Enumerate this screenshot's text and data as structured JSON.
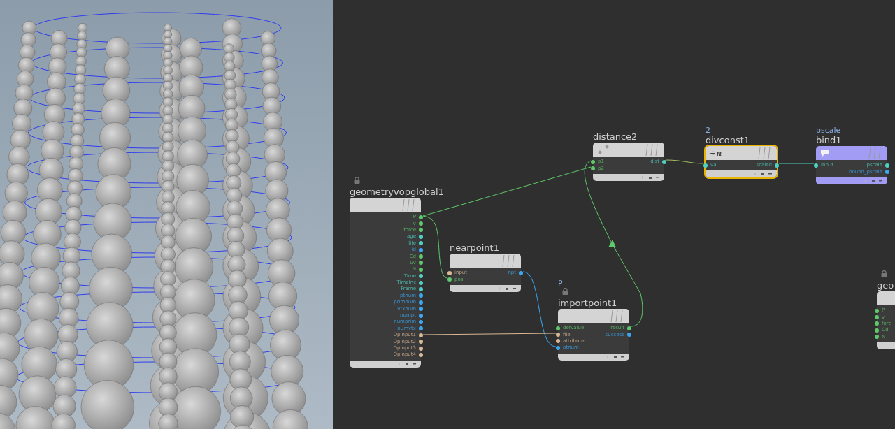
{
  "network": {
    "nodes": [
      {
        "kind": "distance",
        "name": "distance2",
        "locked": false,
        "selected": false,
        "inputs": [
          {
            "name": "p1",
            "color": "#5ec86a"
          },
          {
            "name": "p2",
            "color": "#5ec86a"
          }
        ],
        "outputs": [
          {
            "name": "dist",
            "color": "#4fd1c1"
          }
        ]
      },
      {
        "kind": "divconst",
        "label": "2",
        "name": "divconst1",
        "symbol": "÷n",
        "locked": false,
        "selected": true,
        "inputs": [
          {
            "name": "val",
            "color": "#4fd1c1"
          }
        ],
        "outputs": [
          {
            "name": "scaled",
            "color": "#4fd1c1"
          }
        ]
      },
      {
        "kind": "bind",
        "label": "pscale",
        "name": "bind1",
        "locked": false,
        "selected": false,
        "inputs": [
          {
            "name": "input",
            "color": "#4fd1c1"
          }
        ],
        "outputs": [
          {
            "name": "pscale",
            "color": "#4fd1c1"
          },
          {
            "name": "bound_pscale",
            "color": "#3aa8f0"
          }
        ]
      },
      {
        "kind": "default",
        "name": "geometryvopglobal1",
        "locked": true,
        "selected": false,
        "outputs": [
          {
            "name": "P",
            "color": "#5ec86a"
          },
          {
            "name": "v",
            "color": "#5ec86a"
          },
          {
            "name": "force",
            "color": "#5ec86a"
          },
          {
            "name": "age",
            "color": "#4fd1c1"
          },
          {
            "name": "life",
            "color": "#4fd1c1"
          },
          {
            "name": "id",
            "color": "#3aa8f0"
          },
          {
            "name": "Cd",
            "color": "#5ec86a"
          },
          {
            "name": "uv",
            "color": "#5ec86a"
          },
          {
            "name": "N",
            "color": "#5ec86a"
          },
          {
            "name": "Time",
            "color": "#4fd1c1"
          },
          {
            "name": "TimeInc",
            "color": "#4fd1c1"
          },
          {
            "name": "Frame",
            "color": "#4fd1c1"
          },
          {
            "name": "ptnum",
            "color": "#3aa8f0"
          },
          {
            "name": "primnum",
            "color": "#3aa8f0"
          },
          {
            "name": "vtxnum",
            "color": "#3aa8f0"
          },
          {
            "name": "numpt",
            "color": "#3aa8f0"
          },
          {
            "name": "numprim",
            "color": "#3aa8f0"
          },
          {
            "name": "numvtx",
            "color": "#3aa8f0"
          },
          {
            "name": "OpInput1",
            "color": "#d9b894"
          },
          {
            "name": "OpInput2",
            "color": "#d9b894"
          },
          {
            "name": "OpInput3",
            "color": "#d9b894"
          },
          {
            "name": "OpInput4",
            "color": "#d9b894"
          }
        ]
      },
      {
        "kind": "default",
        "name": "nearpoint1",
        "locked": false,
        "selected": false,
        "inputs": [
          {
            "name": "input",
            "color": "#d9b894"
          },
          {
            "name": "pos",
            "color": "#5ec86a"
          }
        ],
        "outputs": [
          {
            "name": "npt",
            "color": "#3aa8f0"
          }
        ]
      },
      {
        "kind": "default",
        "name": "geo",
        "locked": true,
        "selected": false,
        "inputs": [
          {
            "name": "P",
            "color": "#5ec86a"
          },
          {
            "name": "v",
            "color": "#5ec86a"
          },
          {
            "name": "forc",
            "color": "#5ec86a"
          },
          {
            "name": "Cd",
            "color": "#5ec86a"
          },
          {
            "name": "N",
            "color": "#5ec86a"
          }
        ]
      },
      {
        "kind": "default",
        "label": "P",
        "name": "importpoint1",
        "locked": true,
        "selected": false,
        "inputs": [
          {
            "name": "defvalue",
            "color": "#5ec86a"
          },
          {
            "name": "file",
            "color": "#d9b894"
          },
          {
            "name": "attribute",
            "color": "#d9b894"
          },
          {
            "name": "ptnum",
            "color": "#3aa8f0"
          }
        ],
        "outputs": [
          {
            "name": "result",
            "color": "#5ec86a"
          },
          {
            "name": "success",
            "color": "#3aa8f0"
          }
        ]
      }
    ]
  }
}
